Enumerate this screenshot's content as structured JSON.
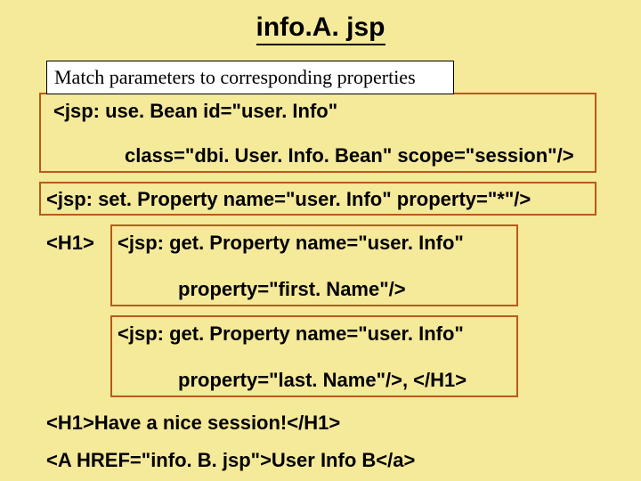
{
  "title": "info.A. jsp",
  "callout": "Match parameters to corresponding properties",
  "code": {
    "line1": "<jsp: use. Bean id=\"user. Info\"",
    "line2": "class=\"dbi. User. Info. Bean\" scope=\"session\"/>",
    "line3": "<jsp: set. Property name=\"user. Info\" property=\"*\"/>",
    "line4a": "<H1>",
    "line4b": "<jsp: get. Property name=\"user. Info\"",
    "line5": "property=\"first. Name\"/>",
    "line6": "<jsp: get. Property name=\"user. Info\"",
    "line7": "property=\"last. Name\"/>, </H1>",
    "line8": "<H1>Have a nice session!</H1>",
    "line9": "<A HREF=\"info. B. jsp\">User Info B</a>"
  }
}
